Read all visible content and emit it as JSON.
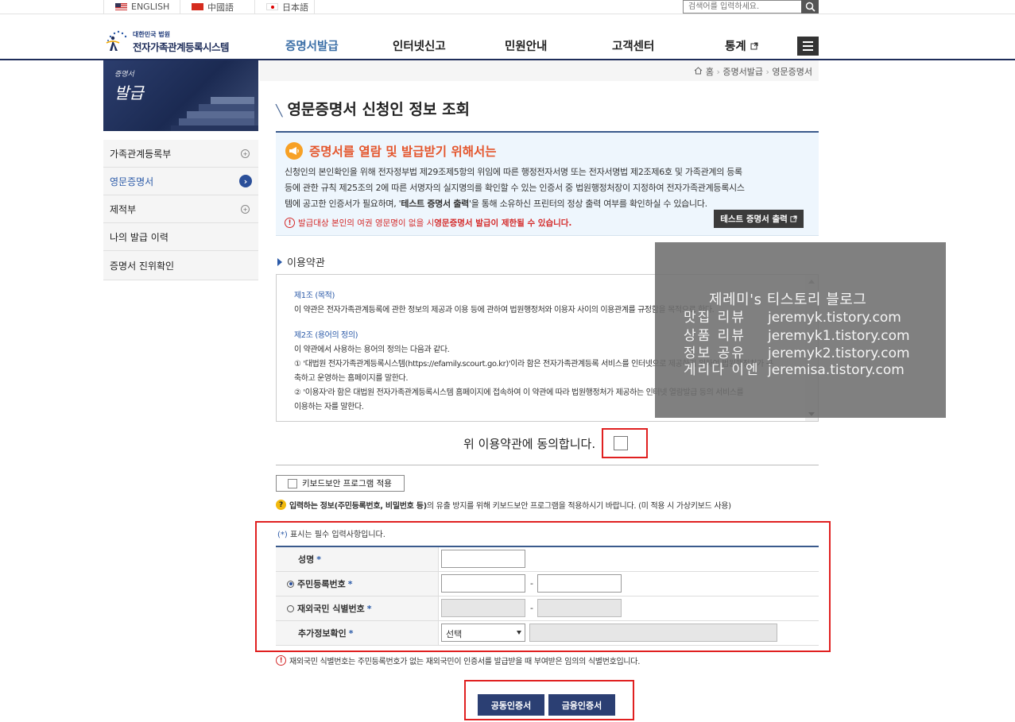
{
  "langbar": {
    "english": "ENGLISH",
    "chinese": "中國語",
    "japanese": "日本語",
    "search_placeholder": "검색어를 입력하세요."
  },
  "header": {
    "logo_sub": "대한민국 법원",
    "logo_main": "전자가족관계등록시스템",
    "nav": [
      "증명서발급",
      "인터넷신고",
      "민원안내",
      "고객센터",
      "통계"
    ],
    "active_nav": "증명서발급"
  },
  "sidebar": {
    "title_small": "증명서",
    "title_big": "발급",
    "items": [
      {
        "label": "가족관계등록부",
        "icon": "plus-circle-icon"
      },
      {
        "label": "영문증명서",
        "icon": "chevron-right-circle-icon"
      },
      {
        "label": "제적부",
        "icon": "plus-circle-icon"
      },
      {
        "label": "나의 발급 이력",
        "icon": ""
      },
      {
        "label": "증명서 진위확인",
        "icon": ""
      }
    ]
  },
  "breadcrumb": {
    "home": "홈",
    "level1": "증명서발급",
    "level2": "영문증명서"
  },
  "page": {
    "title": "영문증명서 신청인 정보 조회"
  },
  "notice": {
    "heading": "증명서를 열람 및 발급받기 위해서는",
    "body_line1": "신청인의 본인확인을 위해 전자정부법 제29조제5항의 위임에 따른 행정전자서명 또는 전자서명법 제2조제6호 및 가족관계의 등록",
    "body_line2": "등에 관한 규칙 제25조의 2에 따른 서명자의 실지명의를 확인할 수 있는 인증서 중 법원행정처장이 지정하여 전자가족관계등록시스",
    "body_line3a": "템에 공고한 인증서가 필요하며, '",
    "body_line3_bold": "테스트 증명서 출력",
    "body_line3b": "'을 통해 소유하신 프린터의 정상 출력 여부를 확인하실 수 있습니다.",
    "warning_a": "발급대상 본인의 여권 영문명이 없을 시 ",
    "warning_b": "영문증명서 발급이 제한될 수 있습니다.",
    "test_button": "테스트 증명서 출력"
  },
  "terms": {
    "section_label": "이용약관",
    "art1_title": "제1조 (목적)",
    "art1_body": "이 약관은 전자가족관계등록에 관한 정보의 제공과 이용 등에 관하여 법원행정처와 이용자 사이의 이용관계를 규정함을 목적으로 한다.",
    "art2_title": "제2조 (용어의 정의)",
    "art2_intro": "이 약관에서 사용하는 용어의 정의는 다음과 같다.",
    "art2_item1a": "① '대법원 전자가족관계등록시스템(https://efamily.scourt.go.kr)'이라 함은 전자가족관계등록 서비스를 인터넷으로 제공하기 위하여 법원행정처가 구",
    "art2_item1b": "축하고 운영하는 홈페이지를 말한다.",
    "art2_item2a": "② '이용자'라 함은 대법원 전자가족관계등록시스템 홈페이지에 접속하여 이 약관에 따라 법원행정처가 제공하는 인터넷 열람발급 등의 서비스를",
    "art2_item2b": "이용하는 자를 말한다.",
    "agree_label": "위 이용약관에 동의합니다.",
    "agree_checked": false
  },
  "keyboard": {
    "button_label": "키보드보안 프로그램 적용",
    "note_bold": "입력하는 정보(주민등록번호, 비밀번호 등)",
    "note_rest": "의 유출 방지를 위해 키보드보안 프로그램을 적용하시기 바랍니다. (미 적용 시 가상키보드 사용)"
  },
  "form": {
    "required_note_star": "(*)",
    "required_note": " 표시는 필수 입력사항입니다.",
    "name_label": "성명",
    "rrn_label": "주민등록번호",
    "overseas_label": "재외국민 식별번호",
    "extra_label": "추가정보확인",
    "select_value": "선택",
    "dash": "-",
    "star": "*",
    "selected_id_type": "rrn"
  },
  "footer": {
    "note": "재외국민 식별번호는 주민등록번호가 없는 재외국민이 인증서를 발급받을 때 부여받은 임의의 식별번호입니다.",
    "btn_public_cert": "공동인증서",
    "btn_finance_cert": "금융인증서"
  },
  "watermark": {
    "title": "제레미's 티스토리 블로그",
    "rows": [
      {
        "k": "맛집 리뷰",
        "v": "jeremyk.tistory.com"
      },
      {
        "k": "상품 리뷰",
        "v": "jeremyk1.tistory.com"
      },
      {
        "k": "정보 공유",
        "v": "jeremyk2.tistory.com"
      },
      {
        "k": "게리다 이엔",
        "v": "jeremisa.tistory.com"
      }
    ]
  },
  "colors": {
    "brand_navy": "#1e2d5a",
    "accent_blue": "#2b5aa8",
    "warning_red": "#d42a2a",
    "highlight_red": "#e02020",
    "notice_orange": "#e4572e"
  }
}
